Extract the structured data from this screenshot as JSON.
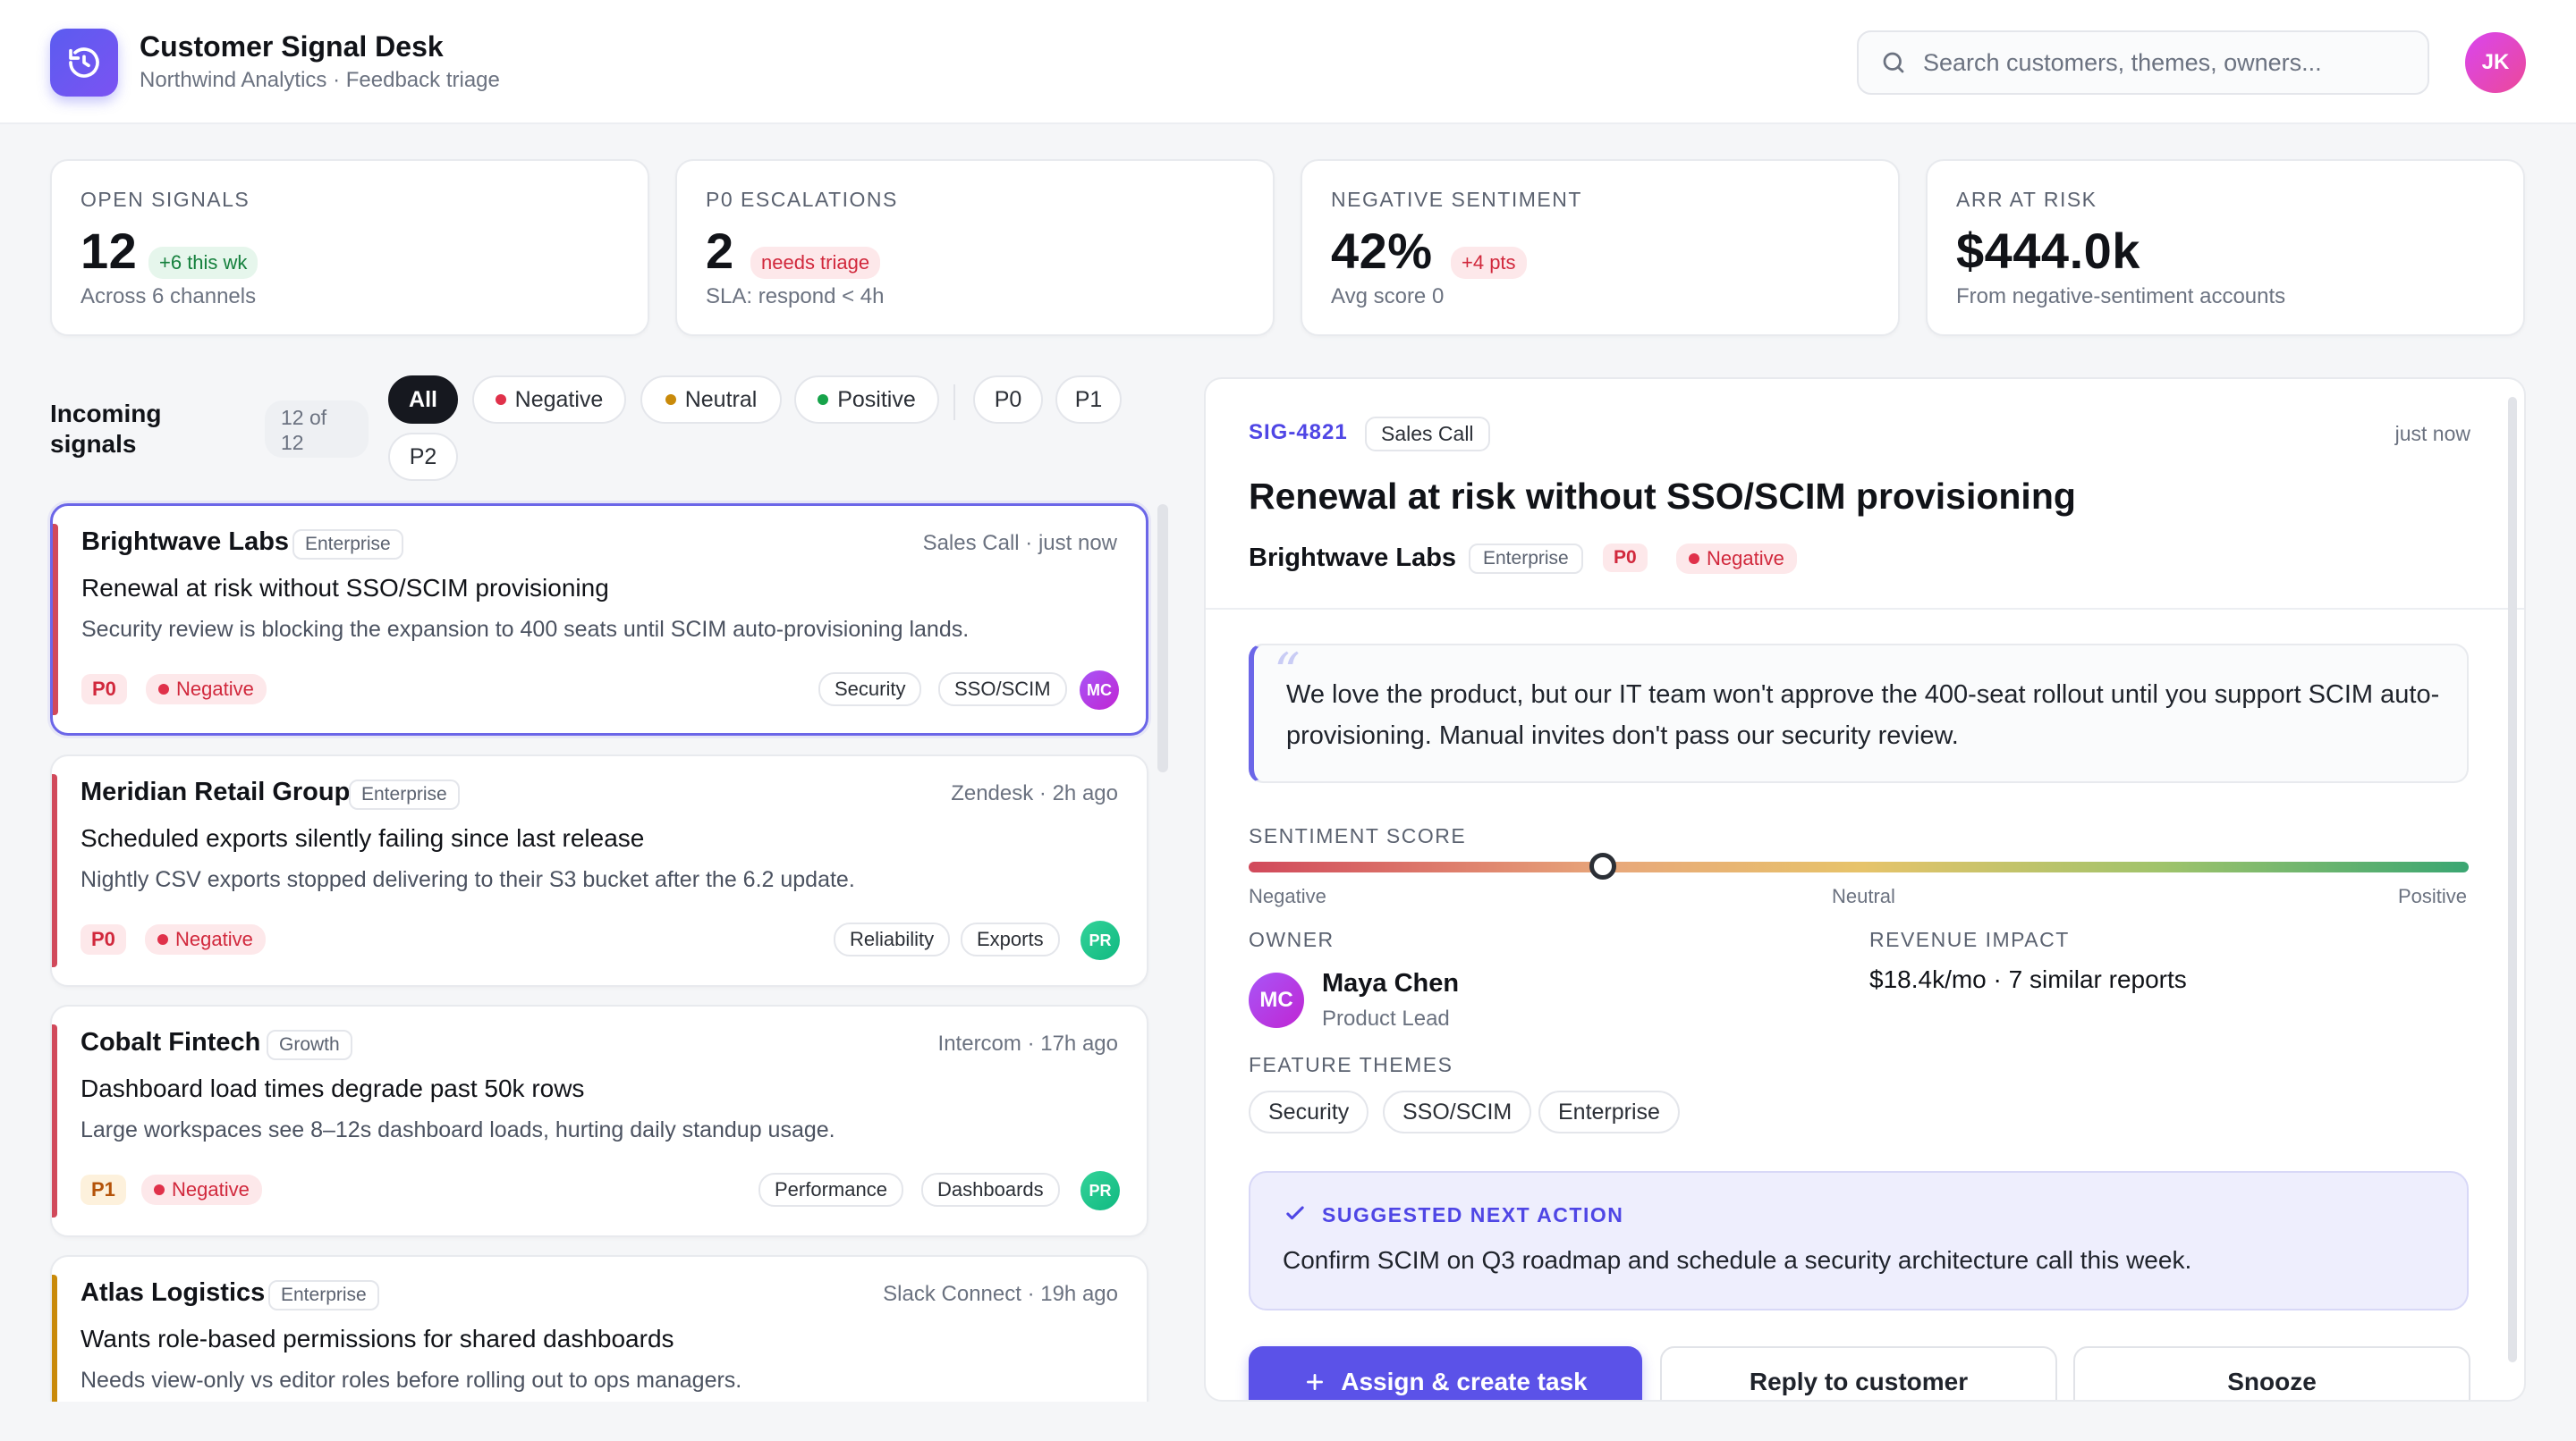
{
  "app": {
    "title": "Customer Signal Desk",
    "subtitle": "Northwind Analytics · Feedback triage",
    "search_placeholder": "Search customers, themes, owners...",
    "user_initials": "JK"
  },
  "stats": [
    {
      "label": "OPEN SIGNALS",
      "value": "12",
      "pill": "+6 this wk",
      "pill_kind": "green",
      "sub": "Across 6 channels"
    },
    {
      "label": "P0 ESCALATIONS",
      "value": "2",
      "pill": "needs triage",
      "pill_kind": "red",
      "sub": "SLA: respond < 4h"
    },
    {
      "label": "NEGATIVE SENTIMENT",
      "value": "42%",
      "pill": "+4 pts",
      "pill_kind": "red",
      "sub": "Avg score 0"
    },
    {
      "label": "ARR AT RISK",
      "value": "$444.0k",
      "sub": "From negative-sentiment accounts"
    }
  ],
  "filters": {
    "heading": "Incoming signals",
    "count": "12 of 12",
    "chips": [
      "All",
      "Negative",
      "Neutral",
      "Positive",
      "P0",
      "P1",
      "P2"
    ],
    "active": "All"
  },
  "signals": [
    {
      "company": "Brightwave Labs",
      "tier": "Enterprise",
      "source": "Sales Call",
      "time": "· just now",
      "title": "Renewal at risk without SSO/SCIM provisioning",
      "desc": "Security review is blocking the expansion to 400 seats until SCIM auto-provisioning lands.",
      "priority": "P0",
      "sentiment": "Negative",
      "tags": [
        "Security",
        "SSO/SCIM"
      ],
      "owner": "MC",
      "bar_color": "#d1495b"
    },
    {
      "company": "Meridian Retail Group",
      "tier": "Enterprise",
      "source": "Zendesk",
      "time": "· 2h ago",
      "title": "Scheduled exports silently failing since last release",
      "desc": "Nightly CSV exports stopped delivering to their S3 bucket after the 6.2 update.",
      "priority": "P0",
      "sentiment": "Negative",
      "tags": [
        "Reliability",
        "Exports"
      ],
      "owner": "PR",
      "bar_color": "#d1495b"
    },
    {
      "company": "Cobalt Fintech",
      "tier": "Growth",
      "source": "Intercom",
      "time": "· 17h ago",
      "title": "Dashboard load times degrade past 50k rows",
      "desc": "Large workspaces see 8–12s dashboard loads, hurting daily standup usage.",
      "priority": "P1",
      "sentiment": "Negative",
      "tags": [
        "Performance",
        "Dashboards"
      ],
      "owner": "PR",
      "bar_color": "#d1495b"
    },
    {
      "company": "Atlas Logistics",
      "tier": "Enterprise",
      "source": "Slack Connect",
      "time": "· 19h ago",
      "title": "Wants role-based permissions for shared dashboards",
      "desc": "Needs view-only vs editor roles before rolling out to ops managers.",
      "bar_color": "#c98a0a"
    }
  ],
  "detail": {
    "id": "SIG-4821",
    "source": "Sales Call",
    "time": "just now",
    "title": "Renewal at risk without SSO/SCIM provisioning",
    "company": "Brightwave Labs",
    "tier": "Enterprise",
    "priority": "P0",
    "sentiment": "Negative",
    "quote": "We love the product, but our IT team won't approve the 400-seat rollout until you support SCIM auto-provisioning. Manual invites don't pass our security review.",
    "sentiment_label": "SENTIMENT SCORE",
    "sentiment_scale": [
      "Negative",
      "Neutral",
      "Positive"
    ],
    "sentiment_position": 0.29,
    "owner_label": "OWNER",
    "owner_name": "Maya Chen",
    "owner_role": "Product Lead",
    "owner_initials": "MC",
    "revenue_label": "REVENUE IMPACT",
    "revenue_value": "$18.4k/mo · 7 similar reports",
    "themes_label": "FEATURE THEMES",
    "themes": [
      "Security",
      "SSO/SCIM",
      "Enterprise"
    ],
    "suggest_label": "SUGGESTED NEXT ACTION",
    "suggest_text": "Confirm SCIM on Q3 roadmap and schedule a security architecture call this week.",
    "buttons": {
      "primary": "Assign & create task",
      "reply": "Reply to customer",
      "snooze": "Snooze"
    }
  },
  "colors": {
    "accent": "#5b52e8",
    "negative": "#d1283c",
    "positive": "#16a34a",
    "neutral": "#c98a0a"
  }
}
